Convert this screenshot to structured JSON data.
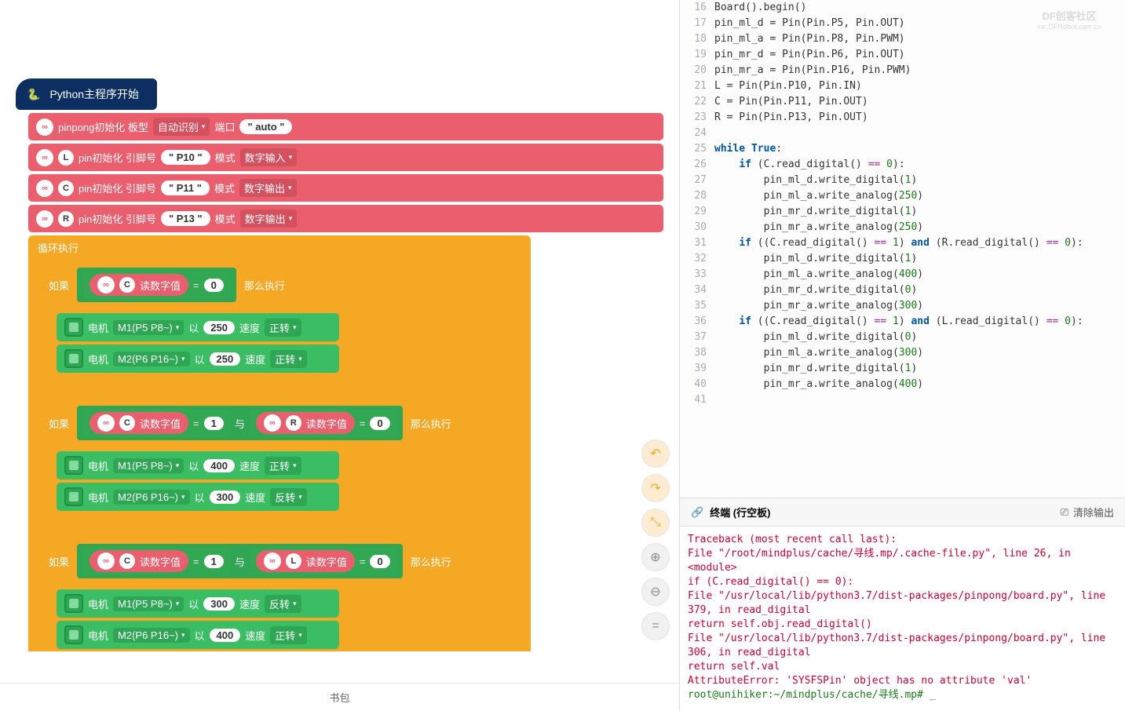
{
  "watermark": {
    "title": "DF创客社区",
    "sub": "mc.DFRobot.com.cn"
  },
  "hat": {
    "python_icon": "🐍",
    "label": "Python主程序开始"
  },
  "init": {
    "row0": {
      "icon": "∞",
      "t1": "pinpong初始化 板型",
      "dd1": "自动识别",
      "t2": "端口",
      "pill": "\" auto \""
    },
    "row1": {
      "letter": "L",
      "t1": "pin初始化 引脚号",
      "pill": "\" P10 \"",
      "t2": "模式",
      "dd": "数字输入"
    },
    "row2": {
      "letter": "C",
      "t1": "pin初始化 引脚号",
      "pill": "\" P11 \"",
      "t2": "模式",
      "dd": "数字输出"
    },
    "row3": {
      "letter": "R",
      "t1": "pin初始化 引脚号",
      "pill": "\" P13 \"",
      "t2": "模式",
      "dd": "数字输出"
    }
  },
  "loop_label": "循环执行",
  "if_label": "如果",
  "then_label": "那么执行",
  "read_label": "读数字值",
  "and_label": "与",
  "motor": {
    "label": "电机",
    "speed_lbl": "速度",
    "as_lbl": "以",
    "fwd": "正转",
    "rev": "反转",
    "m1": "M1(P5 P8~)",
    "m2": "M2(P6 P16~)"
  },
  "ifs": [
    {
      "cond": [
        {
          "v": "C",
          "val": "0"
        }
      ],
      "motors": [
        {
          "m": "m1",
          "spd": "250",
          "dir": "fwd"
        },
        {
          "m": "m2",
          "spd": "250",
          "dir": "fwd"
        }
      ]
    },
    {
      "cond": [
        {
          "v": "C",
          "val": "1"
        },
        {
          "v": "R",
          "val": "0"
        }
      ],
      "motors": [
        {
          "m": "m1",
          "spd": "400",
          "dir": "fwd"
        },
        {
          "m": "m2",
          "spd": "300",
          "dir": "rev"
        }
      ]
    },
    {
      "cond": [
        {
          "v": "C",
          "val": "1"
        },
        {
          "v": "L",
          "val": "0"
        }
      ],
      "motors": [
        {
          "m": "m1",
          "spd": "300",
          "dir": "rev"
        },
        {
          "m": "m2",
          "spd": "400",
          "dir": "fwd"
        }
      ]
    }
  ],
  "bottom_bar": "书包",
  "code": [
    {
      "n": 16,
      "t": "Board().begin()"
    },
    {
      "n": 17,
      "t": "pin_ml_d = Pin(Pin.P5, Pin.OUT)"
    },
    {
      "n": 18,
      "t": "pin_ml_a = Pin(Pin.P8, Pin.PWM)"
    },
    {
      "n": 19,
      "t": "pin_mr_d = Pin(Pin.P6, Pin.OUT)"
    },
    {
      "n": 20,
      "t": "pin_mr_a = Pin(Pin.P16, Pin.PWM)"
    },
    {
      "n": 21,
      "t": "L = Pin(Pin.P10, Pin.IN)"
    },
    {
      "n": 22,
      "t": "C = Pin(Pin.P11, Pin.OUT)"
    },
    {
      "n": 23,
      "t": "R = Pin(Pin.P13, Pin.OUT)"
    },
    {
      "n": 24,
      "t": ""
    },
    {
      "n": 25,
      "t": "while True:",
      "hl": true
    },
    {
      "n": 26,
      "t": "    if (C.read_digital() == 0):",
      "hl": true
    },
    {
      "n": 27,
      "t": "        pin_ml_d.write_digital(1)"
    },
    {
      "n": 28,
      "t": "        pin_ml_a.write_analog(250)"
    },
    {
      "n": 29,
      "t": "        pin_mr_d.write_digital(1)"
    },
    {
      "n": 30,
      "t": "        pin_mr_a.write_analog(250)"
    },
    {
      "n": 31,
      "t": "    if ((C.read_digital() == 1) and (R.read_digital() == 0):",
      "hl": true
    },
    {
      "n": 32,
      "t": "        pin_ml_d.write_digital(1)"
    },
    {
      "n": 33,
      "t": "        pin_ml_a.write_analog(400)"
    },
    {
      "n": 34,
      "t": "        pin_mr_d.write_digital(0)"
    },
    {
      "n": 35,
      "t": "        pin_mr_a.write_analog(300)"
    },
    {
      "n": 36,
      "t": "    if ((C.read_digital() == 1) and (L.read_digital() == 0):",
      "hl": true
    },
    {
      "n": 37,
      "t": "        pin_ml_d.write_digital(0)"
    },
    {
      "n": 38,
      "t": "        pin_ml_a.write_analog(300)"
    },
    {
      "n": 39,
      "t": "        pin_mr_d.write_digital(1)"
    },
    {
      "n": 40,
      "t": "        pin_mr_a.write_analog(400)"
    },
    {
      "n": 41,
      "t": ""
    }
  ],
  "terminal_head": {
    "title": "终端 (行空板)",
    "clear": "清除输出"
  },
  "terminal": [
    {
      "c": "r",
      "t": "Traceback (most recent call last):"
    },
    {
      "c": "r",
      "t": "  File \"/root/mindplus/cache/寻线.mp/.cache-file.py\", line 26, in <module>"
    },
    {
      "c": "r",
      "t": "    if (C.read_digital() == 0):"
    },
    {
      "c": "r",
      "t": "  File \"/usr/local/lib/python3.7/dist-packages/pinpong/board.py\", line 379, in read_digital"
    },
    {
      "c": "r",
      "t": "    return self.obj.read_digital()"
    },
    {
      "c": "r",
      "t": "  File \"/usr/local/lib/python3.7/dist-packages/pinpong/board.py\", line 306, in read_digital"
    },
    {
      "c": "r",
      "t": "    return self.val"
    },
    {
      "c": "r",
      "t": "AttributeError: 'SYSFSPin' object has no attribute 'val'"
    },
    {
      "c": "g",
      "t": "root@unihiker:~/mindplus/cache/寻线.mp# _"
    }
  ]
}
